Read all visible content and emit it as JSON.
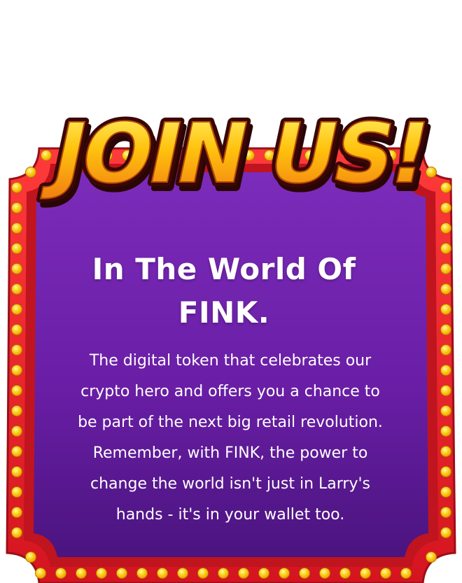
{
  "banner": {
    "text": "JOIN US!"
  },
  "headline": {
    "line1": "In The World Of",
    "line2": "FINK."
  },
  "body": {
    "lines": [
      "The digital token that celebrates our",
      "crypto hero and offers you a chance to",
      "be part of the next big retail revolution.",
      "Remember, with FINK, the power to",
      "change the world isn't just in Larry's",
      "hands - it's in your wallet too."
    ]
  },
  "colors": {
    "frame_red": "#e8202a",
    "frame_dark": "#a3121b",
    "panel_purple_top": "#7a2bb8",
    "panel_purple_bottom": "#4a1580",
    "bulb": "#ffd21c",
    "banner_yellow": "#ffc20e",
    "banner_orange": "#f07a12",
    "text_white": "#ffffff"
  }
}
